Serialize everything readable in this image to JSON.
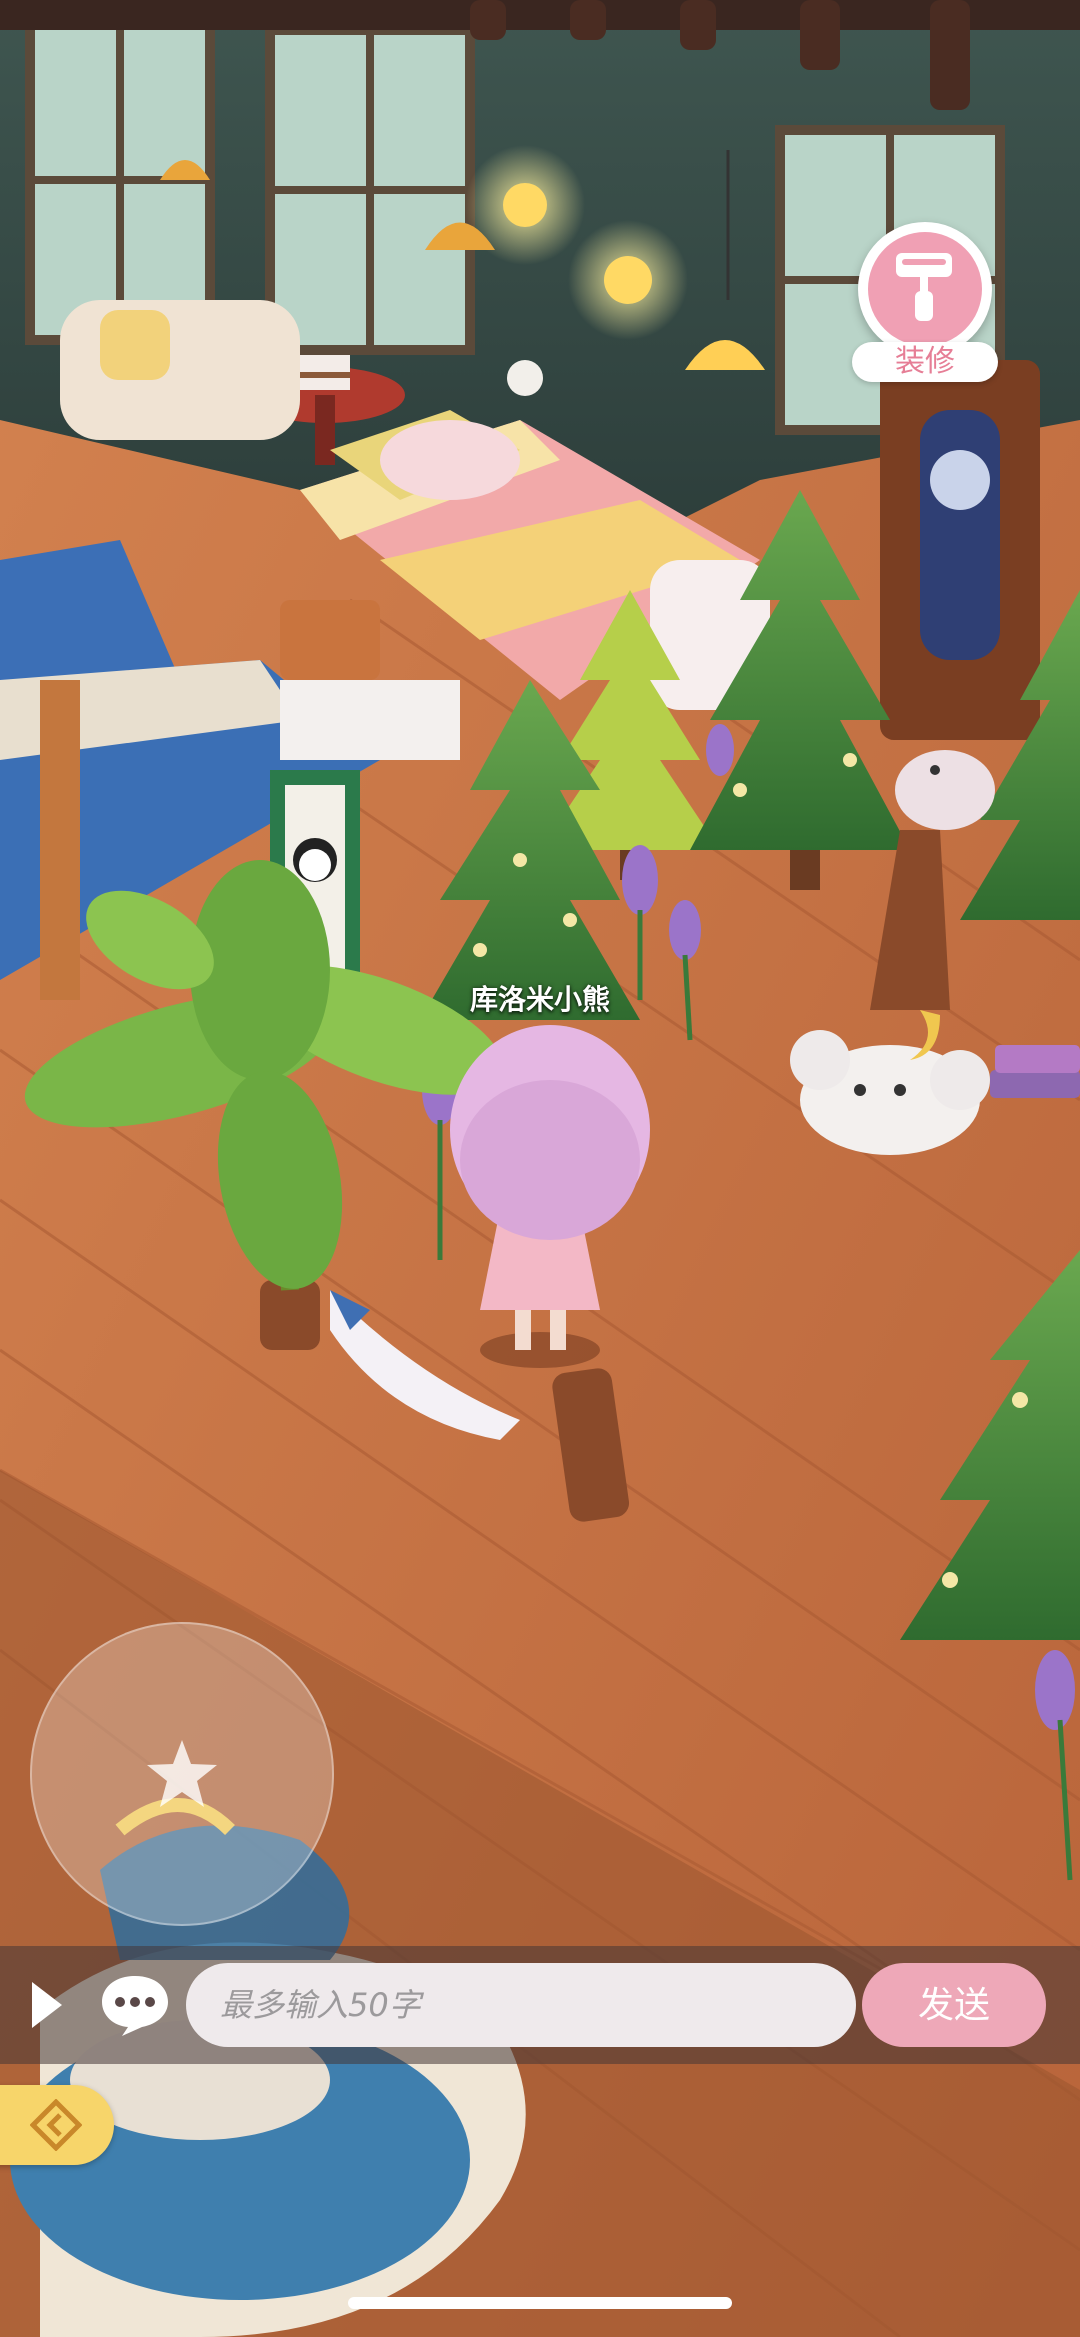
{
  "scene": {
    "player_name": "库洛米小熊"
  },
  "decorate": {
    "label": "装修",
    "icon": "paint-roller-icon"
  },
  "joystick": {
    "icon": "star-icon"
  },
  "chat": {
    "expand_icon": "play-triangle-icon",
    "chat_icon": "speech-bubble-icon",
    "placeholder": "最多输入50字",
    "send_label": "发送"
  },
  "side_tab": {
    "icon": "diamond-arrow-icon"
  },
  "colors": {
    "accent_pink": "#eea8b8",
    "decorate_pink": "#f0a0b4",
    "side_tab_yellow": "#f7d56a",
    "floor_orange": "#c8763f"
  }
}
